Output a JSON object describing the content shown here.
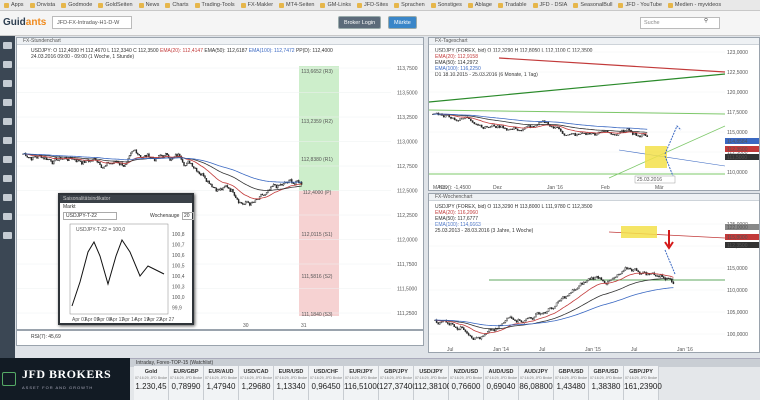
{
  "bookmarks": [
    "Apps",
    "Onvista",
    "Godmode",
    "GoldSeiten",
    "News",
    "Charts",
    "Trading-Tools",
    "FX-Makler",
    "MT4-Seiten",
    "GM-Links",
    "JFD-Sites",
    "Sprachen",
    "Sonstiges",
    "Ablage",
    "Tradable",
    "JFD - DSIA",
    "SeasonalBull",
    "JFD - YouTube",
    "Medien - myvideos"
  ],
  "app": {
    "logo_prefix": "Guid",
    "logo_suffix": "ants",
    "tab_label": "JFD-FX-Intraday-H1-D-W",
    "broker_btn": "Broker Login",
    "market_btn": "Märkte",
    "search_placeholder": "Suche"
  },
  "main_chart": {
    "title": "FX-Stundenchart",
    "legend_line1": "USDJPY: O 112,4030  H 112,4670  L 112,3340  C 112,3500",
    "legend_ema20": "EMA(20): 112,4147",
    "legend_ema50": "EMA(50): 112,6187",
    "legend_ema100": "EMA(100): 112,7472",
    "legend_pp": "PP(D): 112,4000",
    "legend_line2": "24.03.2016 09:00 - 09:00 (1 Woche, 1 Stunde)",
    "price_ticks": [
      "113,7500",
      "113,5000",
      "113,2500",
      "113,0000",
      "112,7500",
      "112,5000",
      "112,2500",
      "112,0000",
      "111,7500",
      "111,5000",
      "111,2500"
    ],
    "pivot_labels": [
      {
        "text": "113,6652 (R3)",
        "color": "#555"
      },
      {
        "text": "113,2359 (R2)",
        "color": "#555"
      },
      {
        "text": "112,8380 (R1)",
        "color": "#555"
      },
      {
        "text": "112,4000 (P)",
        "color": "#555"
      },
      {
        "text": "112,0115 (S1)",
        "color": "#c23a3a"
      },
      {
        "text": "111,5816 (S2)",
        "color": "#c23a3a"
      },
      {
        "text": "111,1840 (S3)",
        "color": "#c23a3a"
      }
    ],
    "date_ticks": [
      "30",
      "31"
    ],
    "rsi_label": "RSI(7): 45,69"
  },
  "mini_window": {
    "title": "Saisonalitätsindikator",
    "subtitle": "Markt",
    "symbol": "USDJPY-T-22",
    "lookback_label": "Wochenauge",
    "lookback_value": "20",
    "legend": "USDJPY-T-22 = 100,0",
    "y_ticks": [
      "100,8",
      "100,7",
      "100,6",
      "100,5",
      "100,4",
      "100,3",
      "100,0",
      "99,9"
    ],
    "x_ticks": [
      "Apr 01",
      "Apr 05",
      "Apr 08",
      "Apr 11",
      "Apr 14",
      "Apr 19",
      "Apr 22",
      "Apr 27"
    ]
  },
  "daily_chart": {
    "title": "FX-Tageschart",
    "legend_line1": "USDJPY (FOREX, bid)  O 112,3290  H 112,8050  L 112,1100  C 112,3500",
    "legend_ema20": "EMA(20): 112,9158",
    "legend_ema50": "EMA(50): 114,2972",
    "legend_ema100": "EMA(100): 116,2250",
    "legend_line2": "D1 18.10.2015 - 25.03.2016 (6 Monate, 1 Tag)",
    "price_ticks": [
      "123,0000",
      "122,5000",
      "120,0000",
      "117,5000",
      "115,0000",
      "112,5000",
      "110,0000"
    ],
    "price_tags": [
      "114,8584",
      "112,3500",
      "111,5000"
    ],
    "date_ticks": [
      "Nov",
      "Dez",
      "Jan '16",
      "Feb",
      "Mär"
    ],
    "date_stamp": "25.03.2016",
    "macd_label": "MACD(): -1,4500"
  },
  "weekly_chart": {
    "title": "FX-Wochenchart",
    "legend_line1": "USDJPY (FOREX, bid)  O 113,3290  H 113,8000  L 111,9780  C 112,3500",
    "legend_ema20": "EMA(20): 116,2060",
    "legend_ema50": "EMA(50): 117,6777",
    "legend_ema100": "EMA(100): 114,6663",
    "legend_line2": "25.03.2013 - 28.03.2016 (3 Jahre, 1 Woche)",
    "price_ticks": [
      "125,0000",
      "120,0000",
      "115,0000",
      "110,0000",
      "105,0000",
      "100,0000"
    ],
    "price_tags": [
      "122,0000",
      "115,8000",
      "112,3500"
    ],
    "date_ticks": [
      "Jul",
      "Jan '14",
      "Jul",
      "Jan '15",
      "Jul",
      "Jan '16"
    ]
  },
  "watchlist": {
    "title": "Intraday, Forex-TOP-15 (Watchlist)",
    "brand_main": "JFD BROKERS",
    "brand_tag": "ASSET FOR AND GROWTH",
    "quotes": [
      {
        "name": "Gold",
        "sub": "07:16:29, JFD Broke",
        "value": "1.230,45"
      },
      {
        "name": "EUR/GBP",
        "sub": "07:16:29, JFD Broke",
        "value": "0,78990"
      },
      {
        "name": "EUR/AUD",
        "sub": "07:16:29, JFD Broke",
        "value": "1,47940"
      },
      {
        "name": "USD/CAD",
        "sub": "07:16:29, JFD Broke",
        "value": "1,29680"
      },
      {
        "name": "EUR/USD",
        "sub": "07:16:29, JFD Broke",
        "value": "1,13340"
      },
      {
        "name": "USD/CHF",
        "sub": "07:16:29, JFD Broke",
        "value": "0,96450"
      },
      {
        "name": "EUR/JPY",
        "sub": "07:16:29, JFD Broke",
        "value": "116,51000"
      },
      {
        "name": "GBP/JPY",
        "sub": "07:16:29, JFD Broke",
        "value": "127,37400"
      },
      {
        "name": "USD/JPY",
        "sub": "07:16:29, JFD Broke",
        "value": "112,38100"
      },
      {
        "name": "NZD/USD",
        "sub": "07:16:29, JFD Broke",
        "value": "0,76600"
      },
      {
        "name": "AUD/USD",
        "sub": "07:16:29, JFD Broke",
        "value": "0,69040"
      },
      {
        "name": "AUD/JPY",
        "sub": "07:16:29, JFD Broke",
        "value": "86,08800"
      },
      {
        "name": "GBP/USD",
        "sub": "07:16:29, JFD Broke",
        "value": "1,43480"
      },
      {
        "name": "GBP/USD",
        "sub": "07:16:29, JFD Broke",
        "value": "1,38380"
      },
      {
        "name": "GBP/JPY",
        "sub": "07:16:29, JFD Broke",
        "value": "161,23900"
      }
    ]
  },
  "colors": {
    "ema20": "#c23a3a",
    "ema50": "#333333",
    "ema100": "#3a68c2",
    "accent": "#f08a1c",
    "pivot_green": "#cdeecb",
    "pivot_red": "#f6d2d2"
  }
}
